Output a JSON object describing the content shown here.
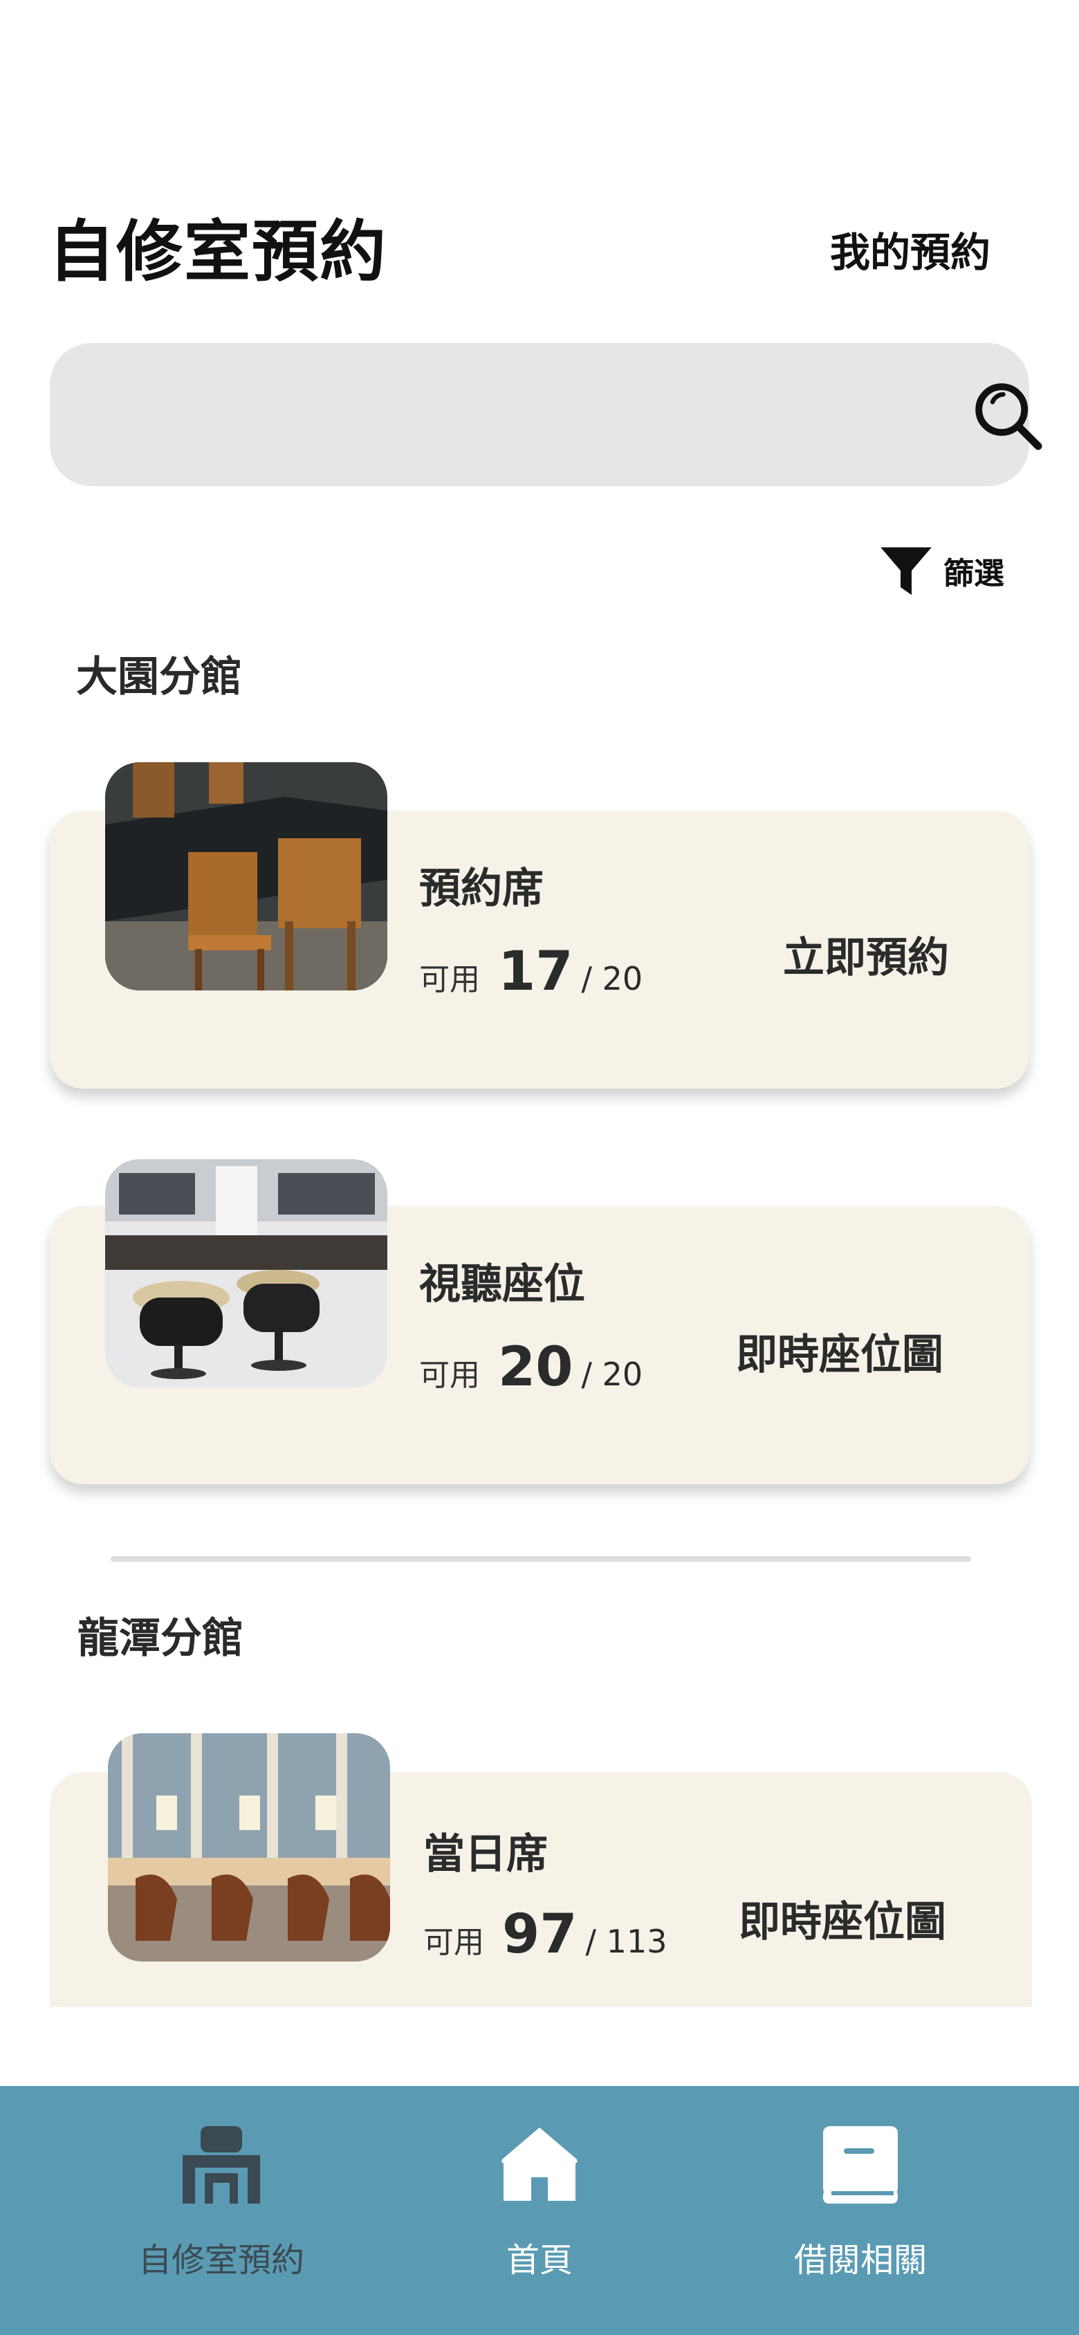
{
  "header": {
    "title": "自修室預約",
    "my_reservations": "我的預約"
  },
  "search": {
    "placeholder": "",
    "icon": "search-icon"
  },
  "filter": {
    "label": "篩選",
    "icon": "funnel-icon"
  },
  "branches": [
    {
      "name": "大園分館",
      "cards": [
        {
          "name": "預約席",
          "available_label": "可用",
          "available": "17",
          "total": "/ 20",
          "action": "立即預約"
        },
        {
          "name": "視聽座位",
          "available_label": "可用",
          "available": "20",
          "total": "/ 20",
          "action": "即時座位圖"
        }
      ]
    },
    {
      "name": "龍潭分館",
      "cards": [
        {
          "name": "當日席",
          "available_label": "可用",
          "available": "97",
          "total": "/ 113",
          "action": "即時座位圖"
        }
      ]
    }
  ],
  "bottom_nav": {
    "items": [
      {
        "label": "自修室預約",
        "icon": "desk-icon",
        "active": true
      },
      {
        "label": "首頁",
        "icon": "home-icon",
        "active": false
      },
      {
        "label": "借閱相關",
        "icon": "book-icon",
        "active": false
      }
    ]
  },
  "colors": {
    "card_bg": "#f7f2e8",
    "nav_bg": "#5a9bb3",
    "nav_active": "#3b4a52",
    "nav_inactive": "#ffffff",
    "search_bg": "#e6e6e6"
  }
}
